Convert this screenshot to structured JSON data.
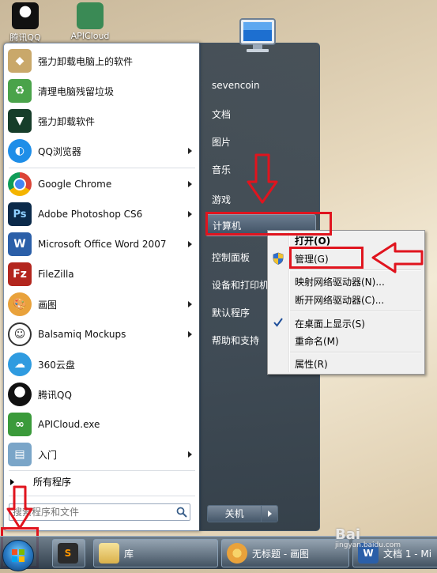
{
  "desktop": {
    "icons": [
      {
        "label": "腾讯QQ"
      },
      {
        "label": "APICloud"
      }
    ]
  },
  "start_menu": {
    "programs": [
      {
        "label": "强力卸载电脑上的软件",
        "icon": "uninstall-icon",
        "color": "#c9a86a",
        "submenu": false
      },
      {
        "label": "清理电脑残留垃圾",
        "icon": "recycle-icon",
        "color": "#4aa34a",
        "submenu": false
      },
      {
        "label": "强力卸载软件",
        "icon": "shield-icon",
        "color": "#2b7a3a",
        "submenu": false
      },
      {
        "label": "QQ浏览器",
        "icon": "qq-browser-icon",
        "color": "#1e8ee8",
        "submenu": true
      },
      {
        "label": "Google Chrome",
        "icon": "chrome-icon",
        "color": "#db4437",
        "submenu": true
      },
      {
        "label": "Adobe Photoshop CS6",
        "icon": "photoshop-icon",
        "color": "#0b2a4a",
        "submenu": true
      },
      {
        "label": "Microsoft Office Word 2007",
        "icon": "word-icon",
        "color": "#2b5fa8",
        "submenu": true
      },
      {
        "label": "FileZilla",
        "icon": "filezilla-icon",
        "color": "#b3261e",
        "submenu": false
      },
      {
        "label": "画图",
        "icon": "paint-icon",
        "color": "#e9a23b",
        "submenu": true
      },
      {
        "label": "Balsamiq Mockups",
        "icon": "balsamiq-icon",
        "color": "#333333",
        "submenu": true
      },
      {
        "label": "360云盘",
        "icon": "cloud-icon",
        "color": "#2f9be0",
        "submenu": false
      },
      {
        "label": "腾讯QQ",
        "icon": "qq-icon",
        "color": "#111111",
        "submenu": false
      },
      {
        "label": "APICloud.exe",
        "icon": "apicloud-icon",
        "color": "#3a9a3a",
        "submenu": false
      },
      {
        "label": "入门",
        "icon": "getting-started-icon",
        "color": "#7aa5c8",
        "submenu": true
      }
    ],
    "all_programs": "所有程序",
    "search_placeholder": "搜索程序和文件",
    "right_items": [
      {
        "label": "sevencoin"
      },
      {
        "label": "文档"
      },
      {
        "label": "图片"
      },
      {
        "label": "音乐"
      },
      {
        "label": "游戏"
      },
      {
        "label": "计算机"
      },
      {
        "label": "控制面板"
      },
      {
        "label": "设备和打印机"
      },
      {
        "label": "默认程序"
      },
      {
        "label": "帮助和支持"
      }
    ],
    "shutdown_label": "关机"
  },
  "context_menu": {
    "items": [
      {
        "label": "打开(O)",
        "bold": true
      },
      {
        "label": "管理(G)",
        "icon": "admin-shield-icon"
      },
      {
        "label": "映射网络驱动器(N)..."
      },
      {
        "label": "断开网络驱动器(C)..."
      },
      {
        "label": "在桌面上显示(S)",
        "checked": true
      },
      {
        "label": "重命名(M)"
      },
      {
        "label": "属性(R)"
      }
    ]
  },
  "taskbar": {
    "buttons": [
      {
        "label": ""
      },
      {
        "label": "库"
      },
      {
        "label": "无标题 - 画图"
      },
      {
        "label": "文档 1 - Mi"
      }
    ]
  },
  "watermark": {
    "text": "Bai",
    "sub": "jingyan.baidu.com"
  },
  "colors": {
    "annotation": "#e0141e"
  }
}
